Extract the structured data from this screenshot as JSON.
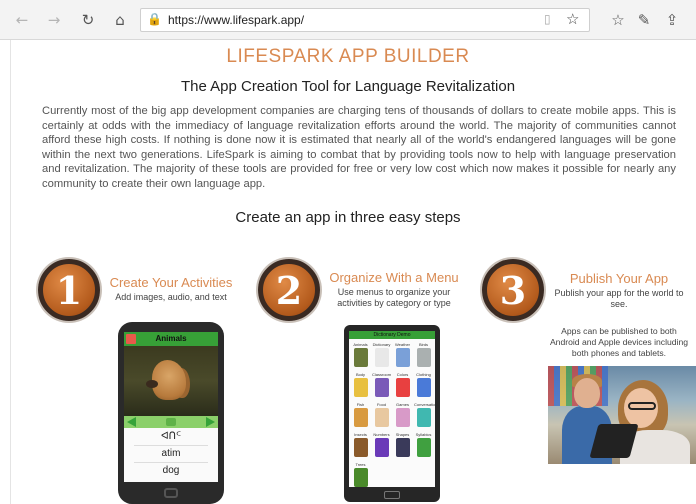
{
  "browser": {
    "url": "https://www.lifespark.app/",
    "icons": [
      "back-icon",
      "forward-icon",
      "refresh-icon",
      "home-icon",
      "lock-icon",
      "reading-view-icon",
      "favorite-star-icon",
      "favorites-list-icon",
      "pen-icon",
      "share-icon"
    ]
  },
  "page": {
    "title": "LIFESPARK APP BUILDER",
    "subtitle": "The App Creation Tool for Language Revitalization",
    "intro": "Currently most of the big app development companies are charging tens of thousands of dollars to create mobile apps. This is certainly at odds with the immediacy of language revitalization efforts around the world. The majority of communities cannot afford these high costs. If nothing is done now it is estimated that nearly all of the world's endangered languages will be gone within the next two generations. LifeSpark is aiming to combat that by providing tools now to help with language preservation and revitalization. The majority of these tools are provided for free or very low cost which now makes it possible for nearly any community to create their own language app.",
    "steps_heading": "Create an app in three easy steps"
  },
  "steps": [
    {
      "number": "1",
      "title": "Create Your Activities",
      "desc": "Add images, audio, and text"
    },
    {
      "number": "2",
      "title": "Organize With a Menu",
      "desc": "Use menus to organize your activities by category or type"
    },
    {
      "number": "3",
      "title": "Publish Your App",
      "desc": "Publish your app for the world to see.",
      "extra": "Apps can be published to both Android and Apple devices including both phones and tablets."
    }
  ],
  "phone1": {
    "header": "Animals",
    "words": [
      "ᐊᑎᒼ",
      "atim",
      "dog"
    ]
  },
  "phone2": {
    "header": "Dictionary Demo",
    "items": [
      {
        "label": "Animals",
        "color": "#6a7a3a"
      },
      {
        "label": "Dictionary",
        "color": "#e8e8e8"
      },
      {
        "label": "Weather",
        "color": "#7aa0d8"
      },
      {
        "label": "Birds",
        "color": "#aab0b0"
      },
      {
        "label": "Body parts",
        "color": "#e8c040"
      },
      {
        "label": "Classroom",
        "color": "#7a5ab8"
      },
      {
        "label": "Colors",
        "color": "#e84040"
      },
      {
        "label": "Clothing",
        "color": "#4a7ad8"
      },
      {
        "label": "Fish",
        "color": "#d89a40"
      },
      {
        "label": "Food",
        "color": "#e8c8a0"
      },
      {
        "label": "Games",
        "color": "#d89ac8"
      },
      {
        "label": "Conversation",
        "color": "#40b8b0"
      },
      {
        "label": "Insects",
        "color": "#8a5a2a"
      },
      {
        "label": "Numbers",
        "color": "#6a3ab8"
      },
      {
        "label": "Shapes",
        "color": "#3a3a5a"
      },
      {
        "label": "Syllabics",
        "color": "#40a040"
      },
      {
        "label": "Trees",
        "color": "#4a8a2a"
      }
    ]
  }
}
